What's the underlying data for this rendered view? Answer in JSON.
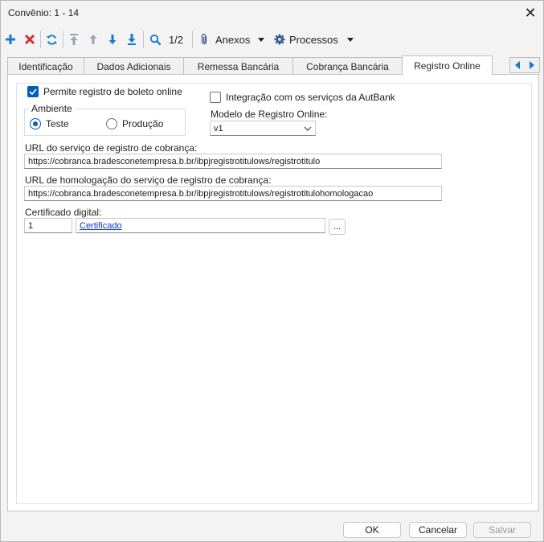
{
  "window": {
    "title": "Convênio: 1 - 14",
    "close_icon": "close-icon"
  },
  "toolbar": {
    "icons": [
      "plus-icon",
      "delete-icon",
      "refresh-icon",
      "first-icon",
      "up-icon",
      "down-icon",
      "last-icon",
      "search-icon"
    ],
    "record_position": "1/2",
    "attachments_label": "Anexos",
    "processes_label": "Processos"
  },
  "tabs": [
    "Identificação",
    "Dados Adicionais",
    "Remessa Bancária",
    "Cobrança Bancária",
    "Registro Online"
  ],
  "active_tab": "Registro Online",
  "form": {
    "enable_online_label": "Permite registro de boleto online",
    "enable_online_checked": true,
    "environment_label": "Ambiente",
    "env_test": "Teste",
    "env_production": "Produção",
    "env_selected": "Teste",
    "autbank_label": "Integração com os serviços da AutBank",
    "autbank_checked": false,
    "model_label": "Modelo de Registro Online:",
    "model_value": "v1",
    "url_label": "URL do serviço de registro de cobrança:",
    "url_value": "https://cobranca.bradesconetempresa.b.br/ibpjregistrotitulows/registrotitulo",
    "url_homolog_label": "URL de homologação do serviço de registro de cobrança:",
    "url_homolog_value": "https://cobranca.bradesconetempresa.b.br/ibpjregistrotitulows/registrotitulohomologacao",
    "cert_label": "Certificado digital:",
    "cert_code": "1",
    "cert_link": "Certificado",
    "cert_browse": "..."
  },
  "buttons": {
    "ok": "OK",
    "cancel": "Cancelar",
    "save": "Salvar"
  },
  "colors": {
    "accent": "#005fb8",
    "add": "#1479d4",
    "delete": "#d03434",
    "link": "#0a36c9"
  }
}
